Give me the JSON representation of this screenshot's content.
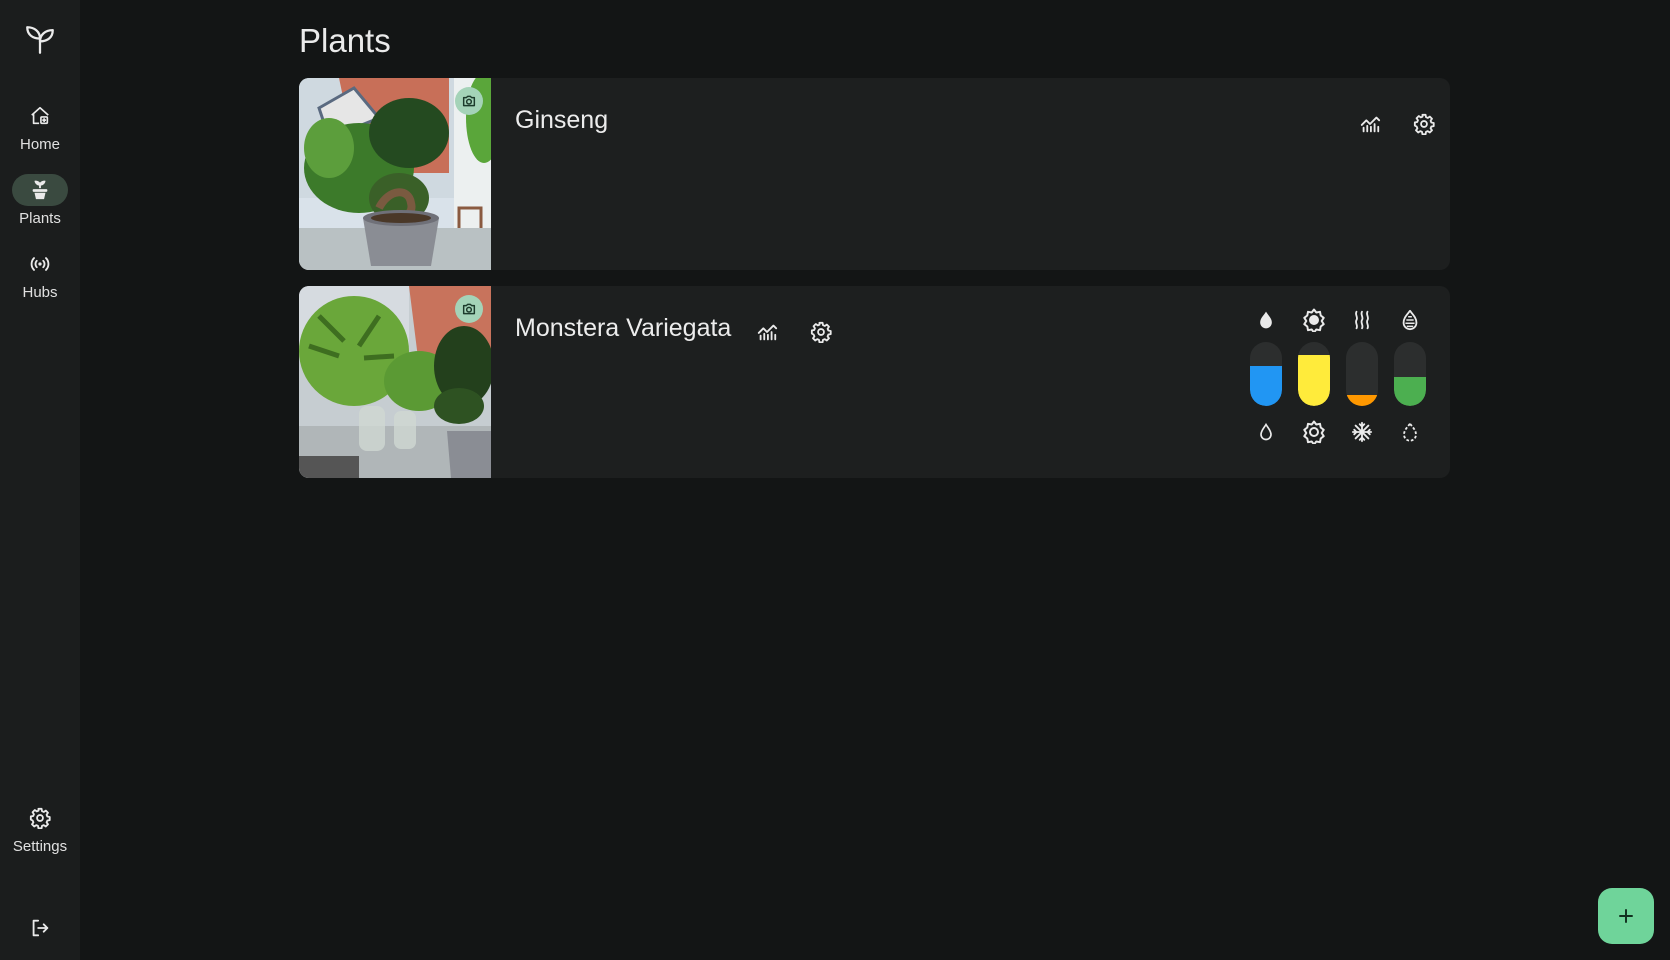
{
  "page": {
    "title": "Plants"
  },
  "nav": {
    "items": [
      {
        "label": "Home",
        "icon": "home-icon"
      },
      {
        "label": "Plants",
        "icon": "potted-plant-icon",
        "active": true
      },
      {
        "label": "Hubs",
        "icon": "broadcast-icon"
      }
    ],
    "settings_label": "Settings",
    "logout_icon": "logout-icon"
  },
  "plants": [
    {
      "name": "Ginseng"
    },
    {
      "name": "Monstera Variegata",
      "meters": [
        {
          "top_icon": "water-drop-filled-icon",
          "bottom_icon": "water-drop-outline-icon",
          "level": 0.62,
          "color": "#2196f3"
        },
        {
          "top_icon": "sun-filled-icon",
          "bottom_icon": "sun-outline-icon",
          "level": 0.8,
          "color": "#ffeb3b"
        },
        {
          "top_icon": "heat-waves-icon",
          "bottom_icon": "snowflake-icon",
          "level": 0.17,
          "color": "#ff9800"
        },
        {
          "top_icon": "fertilizer-filled-icon",
          "bottom_icon": "fertilizer-outline-icon",
          "level": 0.45,
          "color": "#4caf50"
        }
      ]
    }
  ],
  "fab": {
    "label": "+",
    "icon": "add-icon"
  },
  "colors": {
    "background": "#131515",
    "rail": "#1b1d1d",
    "card": "#1d1f1f",
    "accent": "#6fd49a",
    "active_pill": "#3a4a40"
  }
}
